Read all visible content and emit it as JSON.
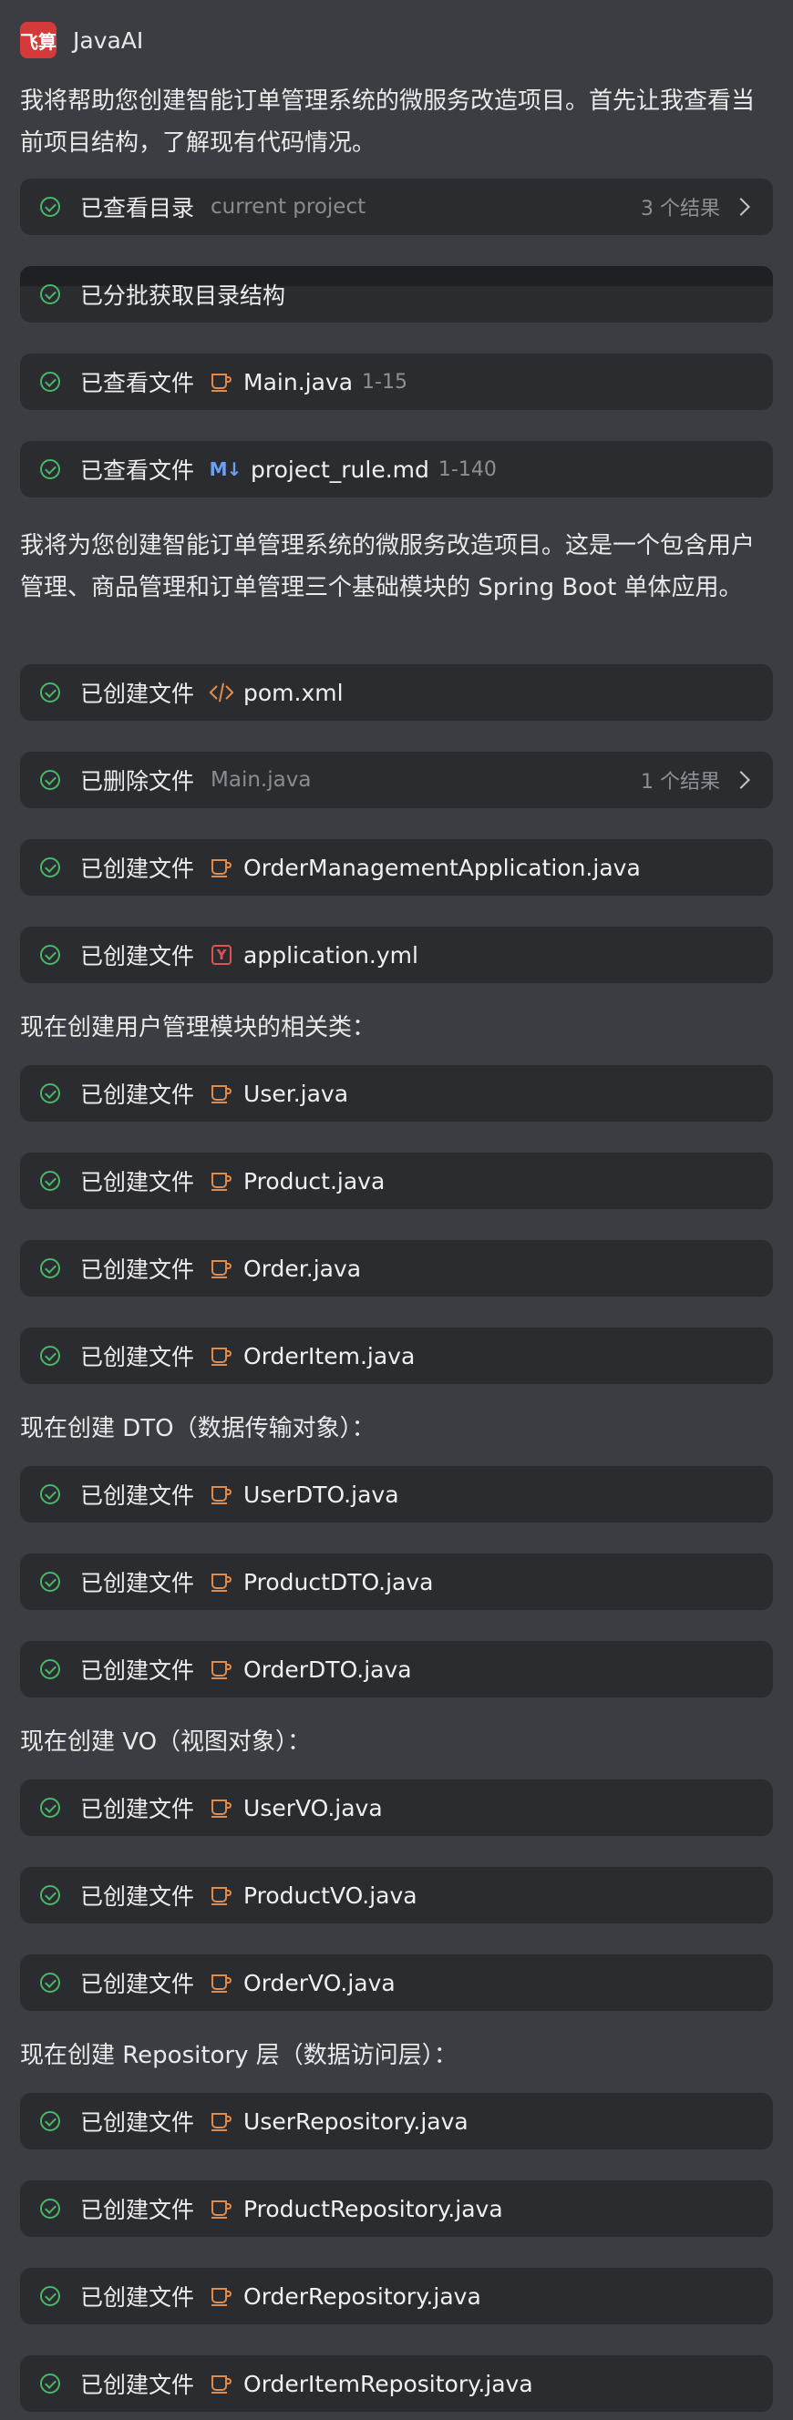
{
  "app": {
    "logo_text": "飞算",
    "title": "JavaAI"
  },
  "paragraphs": [
    "我将帮助您创建智能订单管理系统的微服务改造项目。首先让我查看当前项目结构，了解现有代码情况。",
    "我将为您创建智能订单管理系统的微服务改造项目。这是一个包含用户管理、商品管理和订单管理三个基础模块的 Spring Boot 单体应用。",
    "现在创建用户管理模块的相关类：",
    "现在创建 DTO（数据传输对象）：",
    "现在创建 VO（视图对象）：",
    "现在创建 Repository 层（数据访问层）："
  ],
  "steps": [
    {
      "action": "已查看目录",
      "target": "current project",
      "count": "3 个结果"
    },
    {
      "action": "已分批获取目录结构"
    },
    {
      "action": "已查看文件",
      "icon": "java-cup-icon",
      "file": "Main.java",
      "range": "1-15"
    },
    {
      "action": "已查看文件",
      "icon": "markdown-icon",
      "icon_text": "M↓",
      "file": "project_rule.md",
      "range": "1-140"
    },
    {
      "action": "已创建文件",
      "icon": "xml-code-icon",
      "file": "pom.xml"
    },
    {
      "action": "已删除文件",
      "target": "Main.java",
      "count": "1 个结果"
    },
    {
      "action": "已创建文件",
      "icon": "java-cup-icon",
      "file": "OrderManagementApplication.java"
    },
    {
      "action": "已创建文件",
      "icon": "yaml-icon",
      "icon_text": "Y",
      "file": "application.yml"
    },
    {
      "action": "已创建文件",
      "icon": "java-cup-icon",
      "file": "User.java"
    },
    {
      "action": "已创建文件",
      "icon": "java-cup-icon",
      "file": "Product.java"
    },
    {
      "action": "已创建文件",
      "icon": "java-cup-icon",
      "file": "Order.java"
    },
    {
      "action": "已创建文件",
      "icon": "java-cup-icon",
      "file": "OrderItem.java"
    },
    {
      "action": "已创建文件",
      "icon": "java-cup-icon",
      "file": "UserDTO.java"
    },
    {
      "action": "已创建文件",
      "icon": "java-cup-icon",
      "file": "ProductDTO.java"
    },
    {
      "action": "已创建文件",
      "icon": "java-cup-icon",
      "file": "OrderDTO.java"
    },
    {
      "action": "已创建文件",
      "icon": "java-cup-icon",
      "file": "UserVO.java"
    },
    {
      "action": "已创建文件",
      "icon": "java-cup-icon",
      "file": "ProductVO.java"
    },
    {
      "action": "已创建文件",
      "icon": "java-cup-icon",
      "file": "OrderVO.java"
    },
    {
      "action": "已创建文件",
      "icon": "java-cup-icon",
      "file": "UserRepository.java"
    },
    {
      "action": "已创建文件",
      "icon": "java-cup-icon",
      "file": "ProductRepository.java"
    },
    {
      "action": "已创建文件",
      "icon": "java-cup-icon",
      "file": "OrderRepository.java"
    },
    {
      "action": "已创建文件",
      "icon": "java-cup-icon",
      "file": "OrderItemRepository.java"
    }
  ],
  "colors": {
    "success": "#4bb56b",
    "java": "#e58a45",
    "xml": "#e58a45",
    "yaml": "#e05252",
    "markdown": "#6e9ef0"
  }
}
